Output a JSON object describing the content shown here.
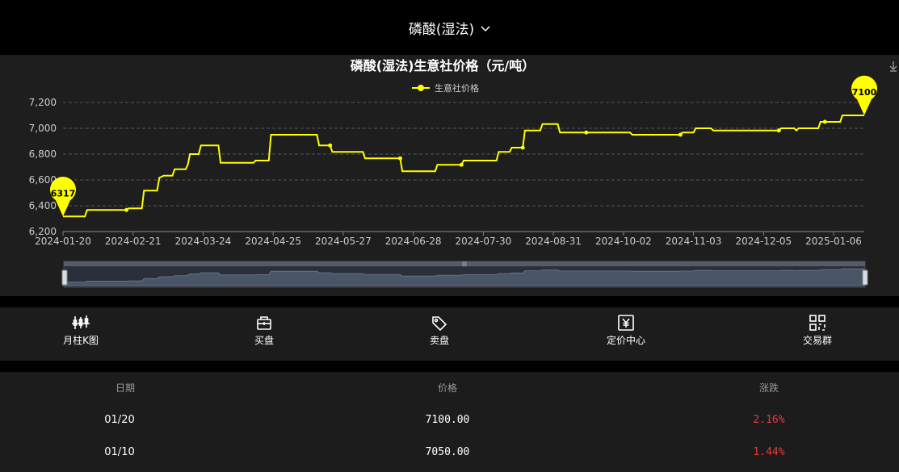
{
  "header": {
    "title": "磷酸(湿法)"
  },
  "chart_data": {
    "type": "line",
    "title": "磷酸(湿法)生意社价格（元/吨）",
    "series": [
      {
        "name": "生意社价格",
        "points": [
          [
            "2024-01-20",
            6317
          ],
          [
            "2024-01-30",
            6317
          ],
          [
            "2024-01-31",
            6367
          ],
          [
            "2024-02-18",
            6367
          ],
          [
            "2024-02-19",
            6380
          ],
          [
            "2024-02-25",
            6380
          ],
          [
            "2024-02-26",
            6517
          ],
          [
            "2024-03-03",
            6517
          ],
          [
            "2024-03-04",
            6617
          ],
          [
            "2024-03-06",
            6633
          ],
          [
            "2024-03-10",
            6633
          ],
          [
            "2024-03-11",
            6683
          ],
          [
            "2024-03-16",
            6683
          ],
          [
            "2024-03-17",
            6717
          ],
          [
            "2024-03-18",
            6800
          ],
          [
            "2024-03-22",
            6800
          ],
          [
            "2024-03-23",
            6867
          ],
          [
            "2024-03-31",
            6867
          ],
          [
            "2024-04-01",
            6733
          ],
          [
            "2024-04-16",
            6733
          ],
          [
            "2024-04-17",
            6750
          ],
          [
            "2024-04-23",
            6750
          ],
          [
            "2024-04-24",
            6950
          ],
          [
            "2024-05-15",
            6950
          ],
          [
            "2024-05-16",
            6867
          ],
          [
            "2024-05-21",
            6867
          ],
          [
            "2024-05-22",
            6817
          ],
          [
            "2024-06-05",
            6817
          ],
          [
            "2024-06-06",
            6767
          ],
          [
            "2024-06-22",
            6767
          ],
          [
            "2024-06-23",
            6667
          ],
          [
            "2024-07-08",
            6667
          ],
          [
            "2024-07-09",
            6717
          ],
          [
            "2024-07-20",
            6717
          ],
          [
            "2024-07-21",
            6750
          ],
          [
            "2024-08-05",
            6750
          ],
          [
            "2024-08-06",
            6817
          ],
          [
            "2024-08-11",
            6817
          ],
          [
            "2024-08-12",
            6850
          ],
          [
            "2024-08-17",
            6850
          ],
          [
            "2024-08-18",
            6983
          ],
          [
            "2024-08-25",
            6983
          ],
          [
            "2024-08-26",
            7033
          ],
          [
            "2024-09-02",
            7033
          ],
          [
            "2024-09-03",
            6967
          ],
          [
            "2024-09-15",
            6967
          ],
          [
            "2024-10-05",
            6967
          ],
          [
            "2024-10-06",
            6950
          ],
          [
            "2024-10-28",
            6950
          ],
          [
            "2024-10-29",
            6967
          ],
          [
            "2024-11-03",
            6967
          ],
          [
            "2024-11-04",
            7000
          ],
          [
            "2024-11-11",
            7000
          ],
          [
            "2024-11-12",
            6983
          ],
          [
            "2024-12-12",
            6983
          ],
          [
            "2024-12-13",
            7000
          ],
          [
            "2024-12-19",
            7000
          ],
          [
            "2024-12-20",
            6983
          ],
          [
            "2024-12-21",
            7000
          ],
          [
            "2024-12-30",
            7000
          ],
          [
            "2024-12-31",
            7050
          ],
          [
            "2025-01-09",
            7050
          ],
          [
            "2025-01-10",
            7100
          ],
          [
            "2025-01-20",
            7100
          ]
        ]
      }
    ],
    "marker_dates": [
      "2024-02-18",
      "2024-05-21",
      "2024-06-22",
      "2024-07-20",
      "2024-08-17",
      "2024-09-15",
      "2024-10-28",
      "2024-12-12",
      "2025-01-02"
    ],
    "ylim": [
      6200,
      7200
    ],
    "yticks": [
      "6,200",
      "6,400",
      "6,600",
      "6,800",
      "7,000",
      "7,200"
    ],
    "ytick_values": [
      6200,
      6400,
      6600,
      6800,
      7000,
      7200
    ],
    "xticks": [
      "2024-01-20",
      "2024-02-21",
      "2024-03-24",
      "2024-04-25",
      "2024-05-27",
      "2024-06-28",
      "2024-07-30",
      "2024-08-31",
      "2024-10-02",
      "2024-11-03",
      "2024-12-05",
      "2025-01-06"
    ],
    "xlim": [
      "2024-01-20",
      "2025-01-20"
    ],
    "pins": [
      {
        "label": "6317",
        "date": "2024-01-20",
        "value": 6317
      },
      {
        "label": "7100",
        "date": "2025-01-20",
        "value": 7100
      }
    ],
    "legend_position": "top-center",
    "grid": true,
    "line_color": "#ffff00"
  },
  "toolbar": [
    {
      "label": "月柱K图",
      "icon": "candlestick-icon"
    },
    {
      "label": "买盘",
      "icon": "bag-icon"
    },
    {
      "label": "卖盘",
      "icon": "tag-icon"
    },
    {
      "label": "定价中心",
      "icon": "yuan-icon"
    },
    {
      "label": "交易群",
      "icon": "grid-icon"
    }
  ],
  "table": {
    "headers": [
      "日期",
      "价格",
      "涨跌"
    ],
    "rows": [
      {
        "date": "01/20",
        "price": "7100.00",
        "change": "2.16%"
      },
      {
        "date": "01/10",
        "price": "7050.00",
        "change": "1.44%"
      }
    ]
  },
  "colors": {
    "up": "#e83b3b",
    "line": "#ffff00",
    "panel": "#1e1e1e"
  }
}
